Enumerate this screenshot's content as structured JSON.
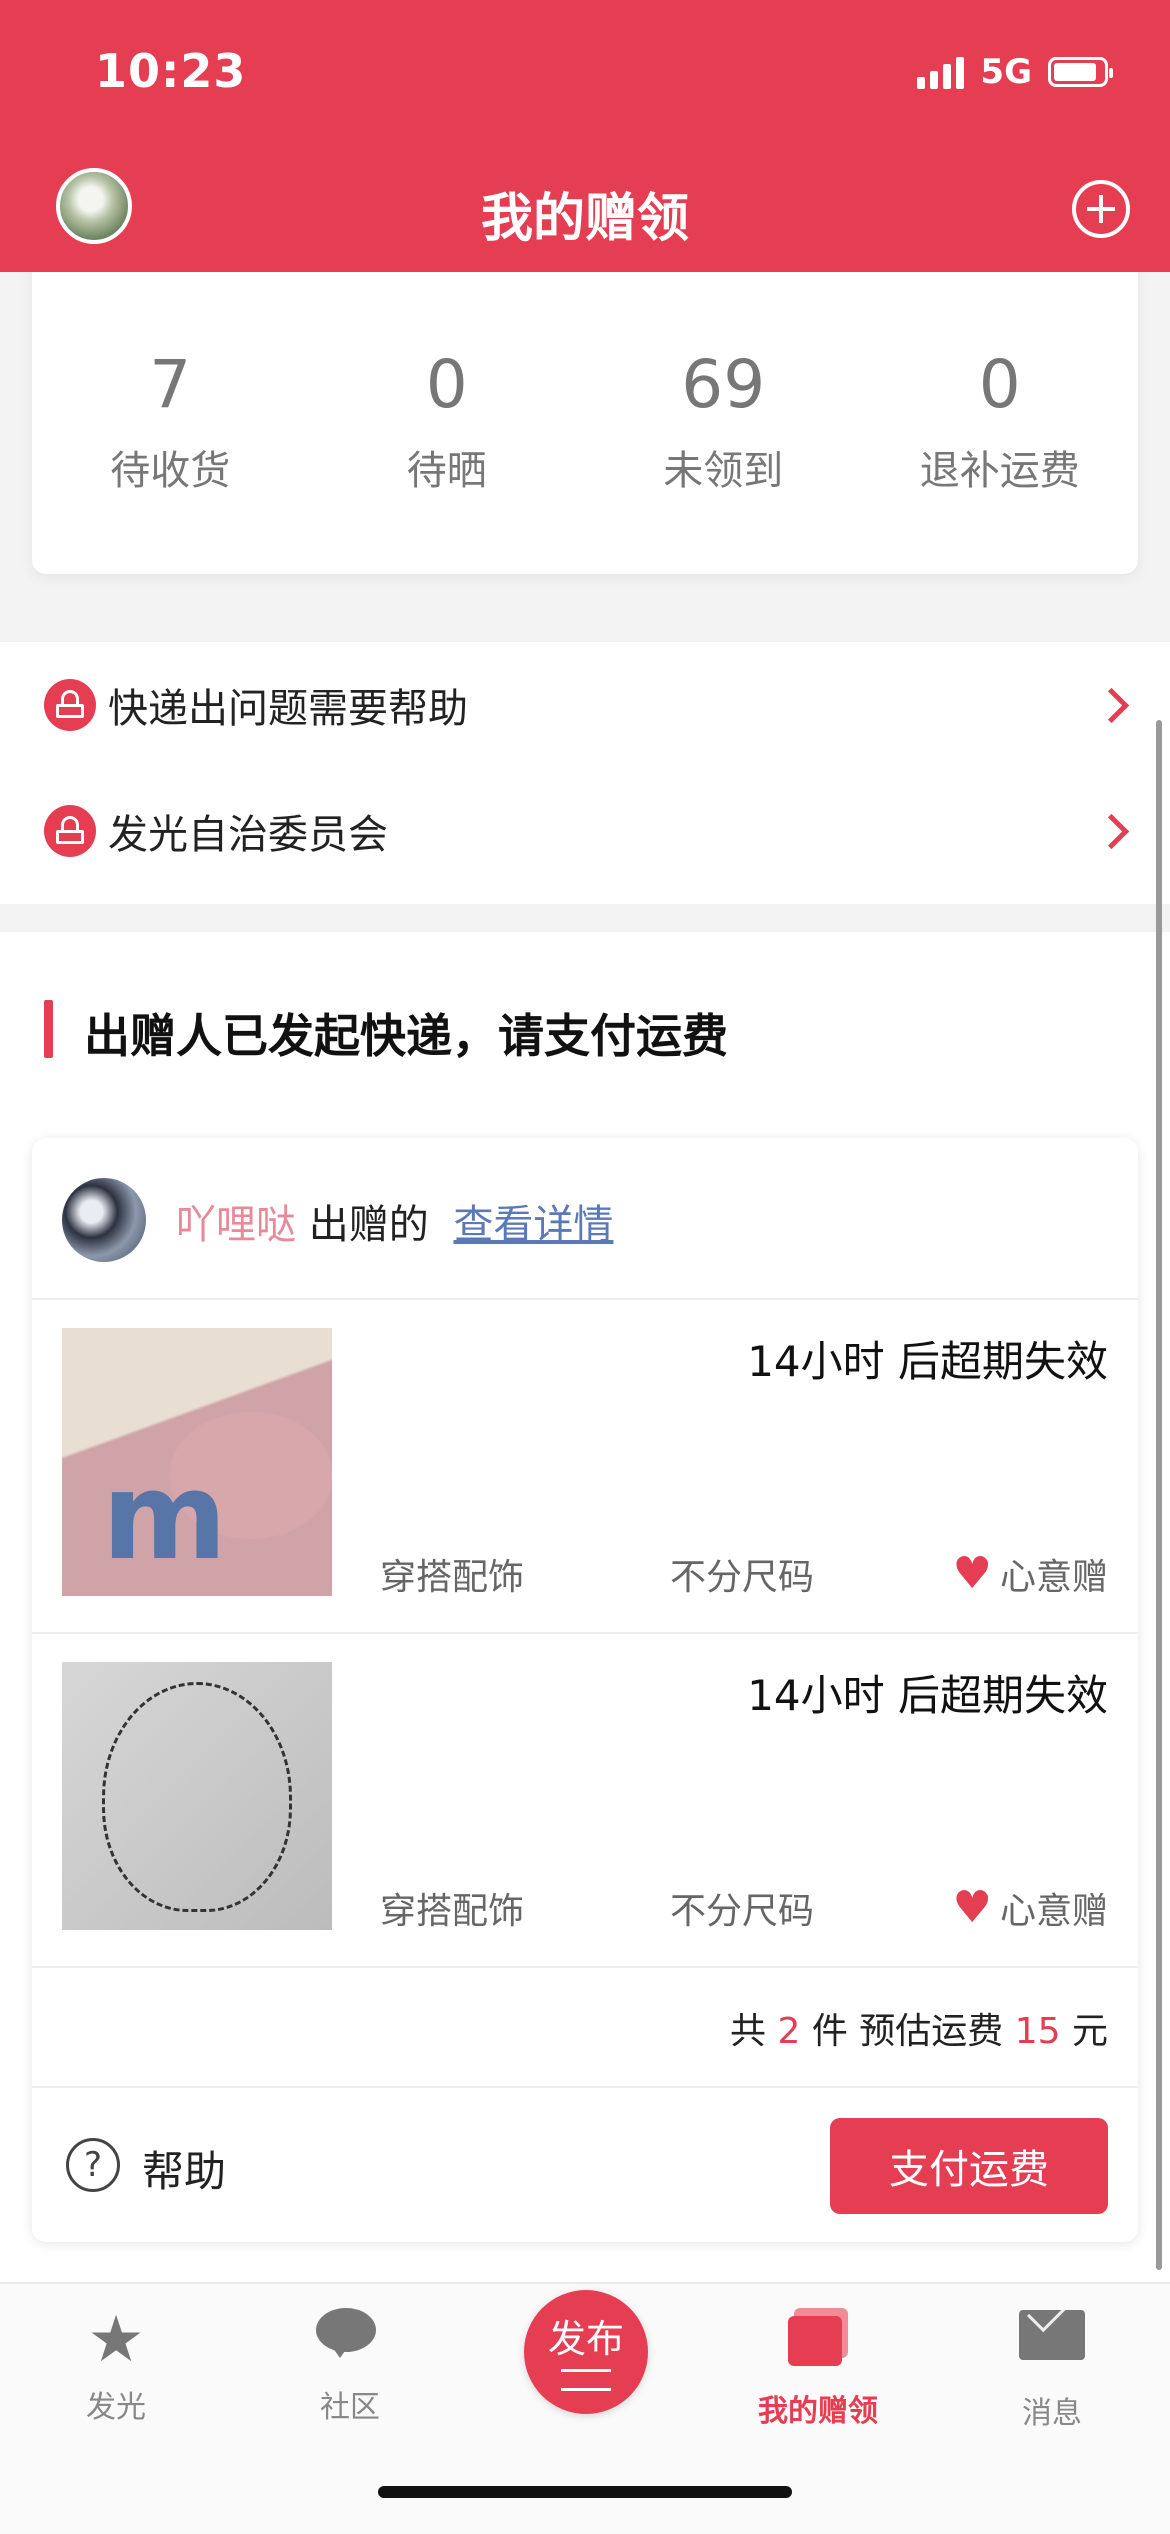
{
  "status_bar": {
    "time": "10:23",
    "network": "5G"
  },
  "header": {
    "title": "我的赠领"
  },
  "stats": [
    {
      "value": "7",
      "label": "待收货"
    },
    {
      "value": "0",
      "label": "待晒"
    },
    {
      "value": "69",
      "label": "未领到"
    },
    {
      "value": "0",
      "label": "退补运费"
    }
  ],
  "links": [
    {
      "label": "快递出问题需要帮助"
    },
    {
      "label": "发光自治委员会"
    }
  ],
  "section": {
    "title": "出赠人已发起快递，请支付运费",
    "giver_name": "吖哩哒",
    "giver_suffix": "出赠的",
    "detail_link": "查看详情",
    "items": [
      {
        "expire": "14小时 后超期失效",
        "category": "穿搭配饰",
        "size": "不分尺码",
        "type": "心意赠"
      },
      {
        "expire": "14小时 后超期失效",
        "category": "穿搭配饰",
        "size": "不分尺码",
        "type": "心意赠"
      }
    ],
    "summary": {
      "prefix": "共",
      "count": "2",
      "count_unit": "件 预估运费",
      "fee": "15",
      "fee_unit": "元"
    },
    "help": "帮助",
    "pay_button": "支付运费"
  },
  "tabs": [
    {
      "label": "发光",
      "icon": "star-icon"
    },
    {
      "label": "社区",
      "icon": "chat-icon"
    },
    {
      "label": "发布",
      "icon": "publish-icon"
    },
    {
      "label": "我的赠领",
      "icon": "gift-box-icon",
      "active": true
    },
    {
      "label": "消息",
      "icon": "mail-icon"
    }
  ],
  "colors": {
    "brand": "#e53e52"
  }
}
